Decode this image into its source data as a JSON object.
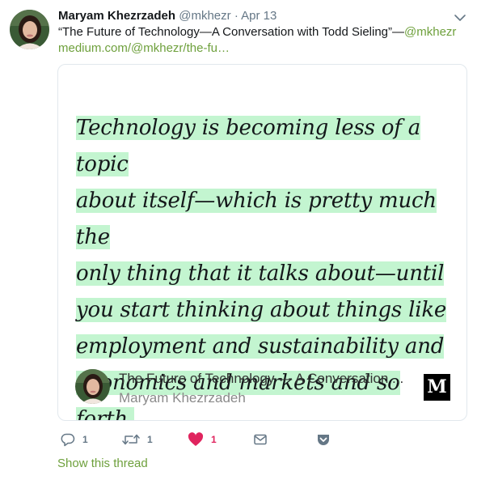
{
  "tweet": {
    "author_name": "Maryam Khezrzadeh",
    "author_handle": "@mkhezr",
    "separator": "·",
    "date": "Apr 13",
    "text_main": "“The Future of Technology—A Conversation with Todd Sieling”—",
    "text_mention": "@mkhezr",
    "url": "medium.com/@mkhezr/the-fu…"
  },
  "card": {
    "quote_lines": [
      "Technology is becoming less of a topic",
      "about itself—which is pretty much the",
      "only thing that it talks about—until",
      "you start thinking about things like",
      "employment and sustainability and",
      "economics and markets and so forth."
    ],
    "highlight_color": "#c3f5d0",
    "title": "The Future of Technology — A Conversation ...",
    "author": "Maryam Khezrzadeh",
    "logo_letter": "M"
  },
  "actions": {
    "reply_count": "1",
    "retweet_count": "1",
    "like_count": "1",
    "like_color": "#e0245e"
  },
  "footer": {
    "show_thread": "Show this thread"
  },
  "colors": {
    "link": "#6ea03c",
    "muted": "#657786"
  }
}
